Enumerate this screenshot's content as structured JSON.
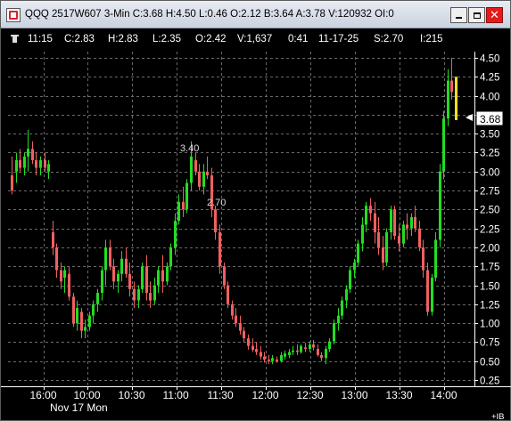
{
  "window": {
    "title": "QQQ 2517W607 3-Min C:3.68 H:4.50 L:0.46 O:2.12 B:3.64 A:3.78 V:120932 OI:0",
    "minimize_icon": "minimize-icon",
    "maximize_icon": "maximize-icon",
    "close_icon": "close-icon",
    "close_color": "#e41b1b"
  },
  "infobar": {
    "time": "11:15",
    "close": "C:2.83",
    "high": "H:2.83",
    "low": "L:2.35",
    "open": "O:2.42",
    "volume": "V:1,637",
    "seconds": "0:41",
    "date": "11-17-25",
    "strike": "S:2.70",
    "index": "I:215"
  },
  "colors": {
    "up": "#22dd22",
    "down": "#f06060",
    "current_bar": "#f2e21a",
    "grid": "#6a6a6a",
    "price_tag_bg": "#ffffff"
  },
  "chart_data": {
    "type": "candlestick",
    "title": "QQQ 2517W607 3-Min",
    "date_label": "Nov 17 Mon",
    "current_price": "3.68",
    "annotations": [
      "3.40",
      "2.70"
    ],
    "ib_label": "+IB",
    "y_ticks": [
      "4.50",
      "4.25",
      "4.00",
      "3.75",
      "3.50",
      "3.25",
      "3.00",
      "2.75",
      "2.50",
      "2.25",
      "2.00",
      "1.75",
      "1.50",
      "1.25",
      "1.00",
      "0.75",
      "0.50",
      "0.25"
    ],
    "x_ticks": [
      "16:00",
      "10:00",
      "10:30",
      "11:00",
      "11:30",
      "12:00",
      "12:30",
      "13:00",
      "13:30",
      "14:00"
    ],
    "ylim": [
      0.25,
      4.5
    ],
    "candles": [
      [
        2.95,
        3.2,
        2.7,
        2.75
      ],
      [
        3.0,
        3.25,
        2.85,
        3.15
      ],
      [
        3.15,
        3.3,
        3.0,
        3.05
      ],
      [
        3.05,
        3.25,
        2.95,
        3.2
      ],
      [
        3.2,
        3.55,
        3.0,
        3.3
      ],
      [
        3.3,
        3.4,
        3.1,
        3.15
      ],
      [
        3.15,
        3.25,
        2.95,
        3.05
      ],
      [
        3.05,
        3.2,
        2.95,
        3.15
      ],
      [
        3.15,
        3.25,
        3.0,
        3.05
      ],
      [
        3.0,
        3.15,
        2.9,
        3.1
      ],
      [
        2.2,
        2.35,
        1.9,
        2.0
      ],
      [
        2.0,
        2.05,
        1.6,
        1.7
      ],
      [
        1.7,
        1.8,
        1.45,
        1.55
      ],
      [
        1.6,
        1.75,
        1.4,
        1.7
      ],
      [
        1.65,
        1.75,
        1.3,
        1.35
      ],
      [
        1.35,
        1.4,
        0.95,
        1.0
      ],
      [
        1.0,
        1.3,
        0.9,
        1.2
      ],
      [
        1.15,
        1.2,
        0.8,
        0.9
      ],
      [
        0.9,
        1.05,
        0.8,
        0.95
      ],
      [
        0.95,
        1.15,
        0.9,
        1.1
      ],
      [
        1.1,
        1.3,
        1.0,
        1.25
      ],
      [
        1.25,
        1.45,
        1.15,
        1.4
      ],
      [
        1.4,
        1.75,
        1.3,
        1.7
      ],
      [
        1.7,
        2.1,
        1.5,
        2.0
      ],
      [
        2.0,
        2.1,
        1.7,
        1.75
      ],
      [
        1.75,
        1.85,
        1.45,
        1.55
      ],
      [
        1.55,
        1.7,
        1.4,
        1.65
      ],
      [
        1.65,
        1.95,
        1.55,
        1.85
      ],
      [
        1.85,
        2.0,
        1.6,
        1.65
      ],
      [
        1.65,
        1.8,
        1.35,
        1.45
      ],
      [
        1.45,
        1.55,
        1.2,
        1.3
      ],
      [
        1.3,
        1.5,
        1.2,
        1.45
      ],
      [
        1.45,
        1.8,
        1.4,
        1.75
      ],
      [
        1.75,
        1.9,
        1.3,
        1.4
      ],
      [
        1.4,
        1.55,
        1.2,
        1.3
      ],
      [
        1.3,
        1.6,
        1.25,
        1.5
      ],
      [
        1.5,
        1.75,
        1.4,
        1.7
      ],
      [
        1.7,
        1.9,
        1.4,
        1.55
      ],
      [
        1.55,
        1.8,
        1.5,
        1.75
      ],
      [
        1.75,
        2.05,
        1.7,
        2.0
      ],
      [
        2.0,
        2.45,
        1.9,
        2.35
      ],
      [
        2.35,
        2.7,
        2.3,
        2.6
      ],
      [
        2.6,
        2.8,
        2.4,
        2.5
      ],
      [
        2.5,
        2.9,
        2.45,
        2.85
      ],
      [
        2.85,
        3.4,
        2.75,
        3.2
      ],
      [
        3.15,
        3.25,
        2.95,
        3.0
      ],
      [
        3.0,
        3.1,
        2.75,
        2.8
      ],
      [
        2.8,
        3.1,
        2.7,
        3.0
      ],
      [
        3.0,
        3.2,
        2.9,
        2.95
      ],
      [
        2.95,
        3.05,
        2.4,
        2.5
      ],
      [
        2.5,
        2.55,
        2.1,
        2.2
      ],
      [
        2.2,
        2.3,
        1.65,
        1.75
      ],
      [
        1.75,
        1.8,
        1.45,
        1.5
      ],
      [
        1.5,
        1.55,
        1.2,
        1.25
      ],
      [
        1.25,
        1.3,
        1.05,
        1.1
      ],
      [
        1.1,
        1.2,
        0.95,
        1.0
      ],
      [
        1.0,
        1.1,
        0.85,
        0.9
      ],
      [
        0.9,
        0.95,
        0.75,
        0.8
      ],
      [
        0.8,
        0.85,
        0.65,
        0.7
      ],
      [
        0.7,
        0.8,
        0.62,
        0.65
      ],
      [
        0.66,
        0.75,
        0.58,
        0.62
      ],
      [
        0.62,
        0.7,
        0.52,
        0.56
      ],
      [
        0.56,
        0.62,
        0.48,
        0.52
      ],
      [
        0.52,
        0.58,
        0.46,
        0.5
      ],
      [
        0.5,
        0.58,
        0.46,
        0.54
      ],
      [
        0.52,
        0.56,
        0.48,
        0.5
      ],
      [
        0.5,
        0.62,
        0.48,
        0.58
      ],
      [
        0.56,
        0.64,
        0.52,
        0.6
      ],
      [
        0.58,
        0.66,
        0.54,
        0.62
      ],
      [
        0.62,
        0.7,
        0.58,
        0.64
      ],
      [
        0.64,
        0.72,
        0.58,
        0.62
      ],
      [
        0.62,
        0.72,
        0.6,
        0.7
      ],
      [
        0.68,
        0.74,
        0.62,
        0.66
      ],
      [
        0.66,
        0.76,
        0.62,
        0.72
      ],
      [
        0.72,
        0.78,
        0.64,
        0.68
      ],
      [
        0.66,
        0.72,
        0.56,
        0.58
      ],
      [
        0.58,
        0.62,
        0.5,
        0.54
      ],
      [
        0.54,
        0.7,
        0.46,
        0.66
      ],
      [
        0.66,
        0.8,
        0.62,
        0.76
      ],
      [
        0.76,
        1.05,
        0.72,
        1.0
      ],
      [
        1.0,
        1.2,
        0.9,
        1.1
      ],
      [
        1.1,
        1.35,
        1.05,
        1.3
      ],
      [
        1.3,
        1.5,
        1.2,
        1.45
      ],
      [
        1.45,
        1.75,
        1.4,
        1.7
      ],
      [
        1.7,
        1.85,
        1.6,
        1.8
      ],
      [
        1.8,
        2.1,
        1.75,
        2.05
      ],
      [
        2.05,
        2.4,
        1.95,
        2.3
      ],
      [
        2.3,
        2.6,
        2.2,
        2.55
      ],
      [
        2.55,
        2.65,
        2.35,
        2.45
      ],
      [
        2.45,
        2.6,
        2.05,
        2.2
      ],
      [
        2.2,
        2.4,
        1.9,
        2.0
      ],
      [
        2.0,
        2.15,
        1.7,
        1.8
      ],
      [
        1.8,
        2.25,
        1.75,
        2.2
      ],
      [
        2.2,
        2.55,
        2.1,
        2.5
      ],
      [
        2.5,
        2.55,
        2.1,
        2.15
      ],
      [
        2.15,
        2.3,
        1.95,
        2.05
      ],
      [
        2.05,
        2.35,
        2.0,
        2.3
      ],
      [
        2.3,
        2.45,
        2.1,
        2.25
      ],
      [
        2.25,
        2.45,
        2.15,
        2.4
      ],
      [
        2.4,
        2.55,
        2.2,
        2.25
      ],
      [
        2.25,
        2.35,
        1.95,
        2.0
      ],
      [
        2.0,
        2.1,
        1.6,
        1.7
      ],
      [
        1.7,
        1.8,
        1.1,
        1.15
      ],
      [
        1.15,
        1.65,
        1.1,
        1.6
      ],
      [
        1.6,
        2.2,
        1.55,
        2.1
      ],
      [
        2.1,
        3.1,
        2.0,
        3.0
      ],
      [
        3.0,
        3.8,
        2.9,
        3.7
      ],
      [
        3.7,
        4.35,
        3.6,
        4.2
      ],
      [
        4.2,
        4.5,
        3.95,
        4.05
      ],
      [
        4.25,
        4.25,
        3.68,
        3.68
      ]
    ]
  }
}
